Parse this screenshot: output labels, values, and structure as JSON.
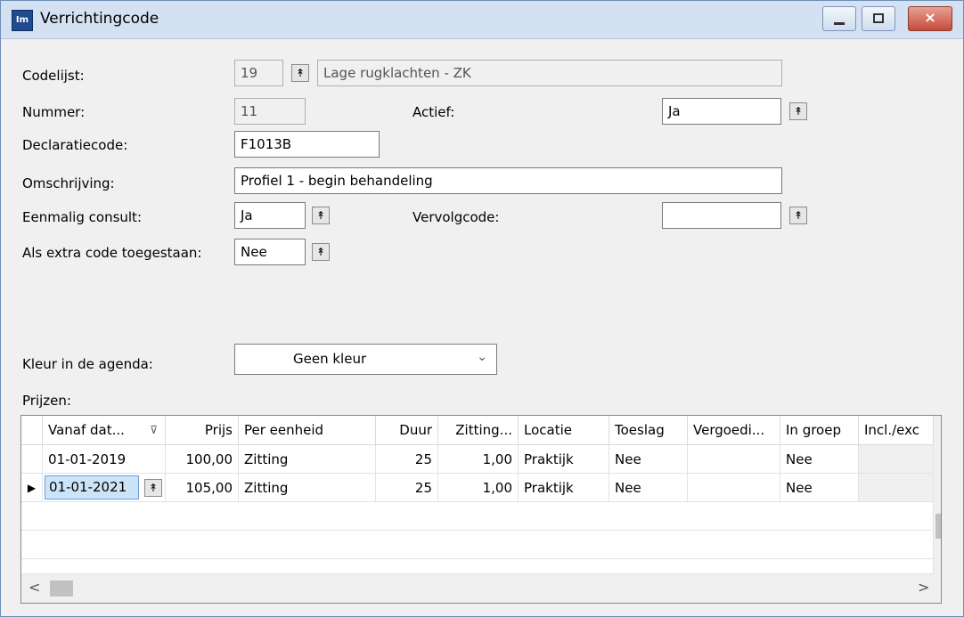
{
  "window": {
    "title": "Verrichtingcode",
    "icon_label": "Im",
    "controls": {
      "minimize": "minimize-icon",
      "maximize": "maximize-icon",
      "close": "×"
    }
  },
  "form": {
    "codelijst": {
      "label": "Codelijst:",
      "number": "19",
      "name": "Lage rugklachten - ZK"
    },
    "nummer": {
      "label": "Nummer:",
      "value": "11"
    },
    "actief": {
      "label": "Actief:",
      "value": "Ja"
    },
    "declaratiecode": {
      "label": "Declaratiecode:",
      "value": "F1013B"
    },
    "omschrijving": {
      "label": "Omschrijving:",
      "value": "Profiel 1 - begin behandeling"
    },
    "eenmalig": {
      "label": "Eenmalig consult:",
      "value": "Ja"
    },
    "vervolgcode": {
      "label": "Vervolgcode:",
      "value": ""
    },
    "extra_code": {
      "label": "Als extra code toegestaan:",
      "value": "Nee"
    },
    "kleur": {
      "label": "Kleur in de agenda:",
      "value": "Geen kleur"
    },
    "prijzen_label": "Prijzen:"
  },
  "grid": {
    "columns": [
      "Vanaf dat...",
      "Prijs",
      "Per eenheid",
      "Duur",
      "Zitting...",
      "Locatie",
      "Toeslag",
      "Vergoedi...",
      "In groep",
      "Incl./exc"
    ],
    "rows": [
      {
        "vanaf": "01-01-2019",
        "prijs": "100,00",
        "eenheid": "Zitting",
        "duur": "25",
        "zitting": "1,00",
        "locatie": "Praktijk",
        "toeslag": "Nee",
        "vergoeding": "",
        "groep": "Nee",
        "incl": ""
      },
      {
        "vanaf": "01-01-2021",
        "prijs": "105,00",
        "eenheid": "Zitting",
        "duur": "25",
        "zitting": "1,00",
        "locatie": "Praktijk",
        "toeslag": "Nee",
        "vergoeding": "",
        "groep": "Nee",
        "incl": ""
      }
    ],
    "current_row_marker": "▶",
    "sort_indicator": "⊽"
  },
  "icons": {
    "spin": "↟",
    "chevron_down": "⌄",
    "scroll_up": "^",
    "scroll_down": "v",
    "scroll_left": "<",
    "scroll_right": ">"
  }
}
